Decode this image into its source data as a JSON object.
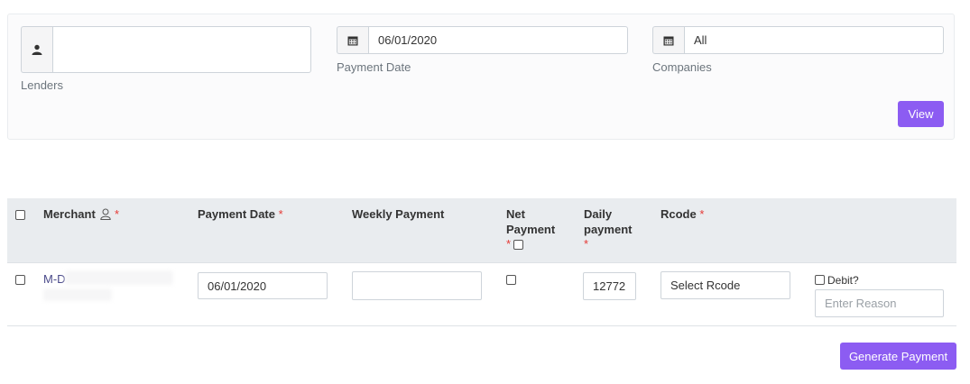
{
  "filters": {
    "lenders": {
      "label": "Lenders",
      "value": ""
    },
    "payment_date": {
      "label": "Payment Date",
      "value": "06/01/2020"
    },
    "companies": {
      "label": "Companies",
      "value": "All"
    },
    "view_label": "View"
  },
  "table": {
    "headers": {
      "merchant": "Merchant",
      "payment_date": "Payment Date",
      "weekly_payment": "Weekly Payment",
      "net_payment_line1": "Net",
      "net_payment_line2": "Payment",
      "daily_payment_line1": "Daily",
      "daily_payment_line2": "payment",
      "rcode": "Rcode"
    },
    "required_mark": "*",
    "row": {
      "merchant": "M-D",
      "payment_date": "06/01/2020",
      "weekly_payment": "",
      "daily_payment": "12772",
      "rcode": "Select Rcode",
      "debit_label": "Debit?",
      "reason_placeholder": "Enter Reason"
    }
  },
  "generate_label": "Generate Payment",
  "colors": {
    "accent": "#8c5cf2",
    "required": "#e53935",
    "link": "#4a4a8a"
  }
}
